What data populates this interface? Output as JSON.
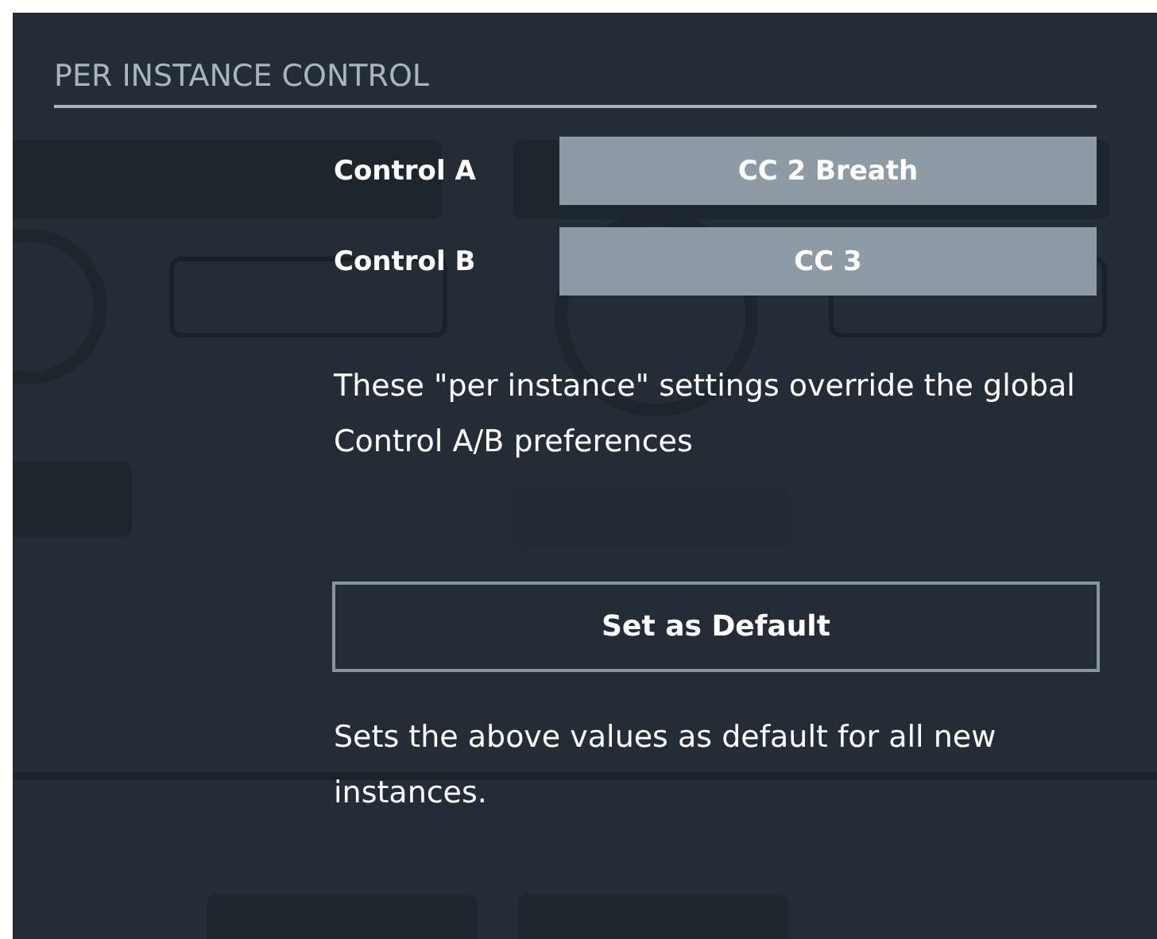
{
  "title": "PER INSTANCE CONTROL",
  "controls": [
    {
      "label": "Control A",
      "value": "CC 2 Breath"
    },
    {
      "label": "Control B",
      "value": "CC 3"
    }
  ],
  "note": "These \"per instance\" settings override the global Control A/B preferences",
  "default_button": "Set as Default",
  "default_note": "Sets the above values as default for all new instances."
}
